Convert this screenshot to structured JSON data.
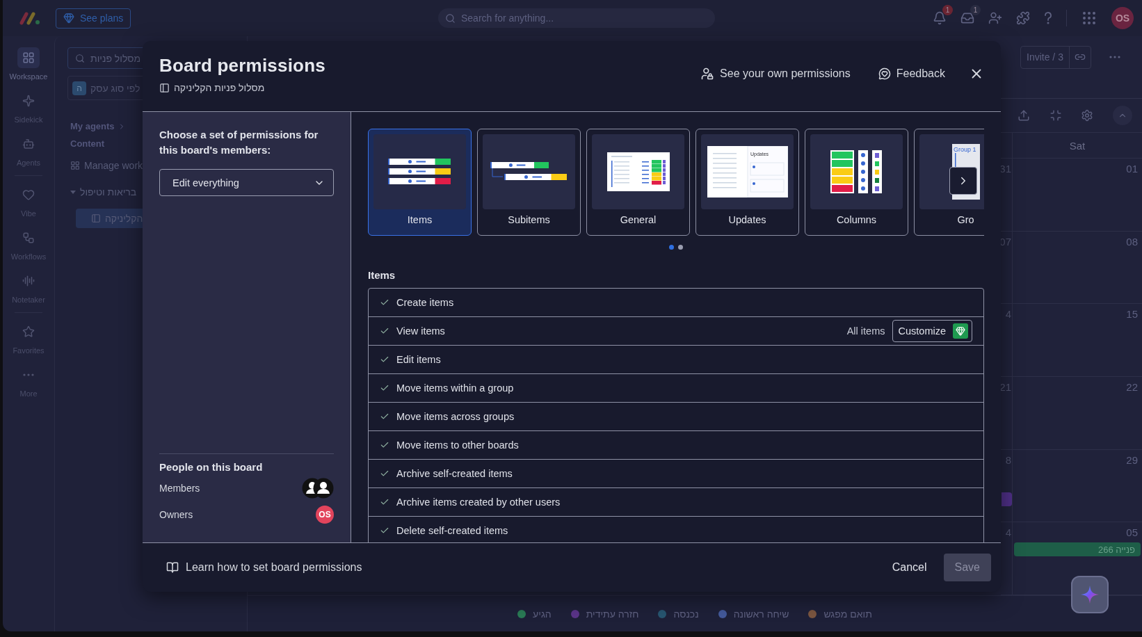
{
  "top_bar": {
    "see_plans": "See plans",
    "search": {
      "placeholder": "Search for anything..."
    },
    "notification_count": "1",
    "inbox_count": "1",
    "avatar": "OS"
  },
  "rail": [
    {
      "label": "Workspace",
      "selected": true
    },
    {
      "label": "Sidekick",
      "selected": false
    },
    {
      "label": "Agents",
      "selected": false
    },
    {
      "label": "Vibe",
      "selected": false
    },
    {
      "label": "Workflows",
      "selected": false
    },
    {
      "label": "Notetaker",
      "selected": false
    },
    {
      "label": "Favorites",
      "selected": false
    },
    {
      "label": "More",
      "selected": false
    }
  ],
  "sidebar": {
    "search": {
      "value": "מסלול פניות"
    },
    "workspace": {
      "initial": "ה",
      "name": "לפי סוג עסק"
    },
    "my_agents": "My agents",
    "section": "Content",
    "items": [
      {
        "label": "Manage work",
        "selected": false
      },
      {
        "label": "בריאות וטיפול",
        "selected": false,
        "expanded": true,
        "children": [
          {
            "label": "הקליניקה",
            "selected": true
          }
        ]
      }
    ]
  },
  "board": {
    "invite": "Invite / 3",
    "calendar": {
      "day": "Sat",
      "weeks": [
        {
          "previous": "31",
          "date": "01"
        },
        {
          "previous": "07",
          "date": "08"
        },
        {
          "previous": "4",
          "date": "15"
        },
        {
          "previous": "21",
          "date": "22"
        },
        {
          "previous": "8",
          "date": "29",
          "previous_event": {
            "color": "#4e2f86"
          }
        },
        {
          "previous": "4",
          "date": "05",
          "event": {
            "text": "פנייה 266",
            "color": "#1e5e48"
          }
        }
      ]
    },
    "legend": [
      {
        "label": "תואם מפגש",
        "color": "#7a5540"
      },
      {
        "label": "שיחה ראשונה",
        "color": "#43599a"
      },
      {
        "label": "נכנסה",
        "color": "#275570"
      },
      {
        "label": "חזרה עתידית",
        "color": "#5a3488"
      },
      {
        "label": "הגיע",
        "color": "#2a7a55"
      }
    ]
  },
  "modal": {
    "title": "Board permissions",
    "board_name": "מסלול פניות הקליניקה",
    "own_permissions": "See your own permissions",
    "feedback": "Feedback",
    "prompt": "Choose a set of permissions for this board's members:",
    "preset": {
      "value": "Edit everything"
    },
    "people": {
      "title": "People on this board",
      "members": "Members",
      "owners": "Owners",
      "owner_avatar": "OS"
    },
    "categories": [
      {
        "label": "Items",
        "kind": "items",
        "selected": true
      },
      {
        "label": "Subitems",
        "kind": "subitems",
        "selected": false
      },
      {
        "label": "General",
        "kind": "general",
        "selected": false
      },
      {
        "label": "Updates",
        "kind": "updates",
        "selected": false,
        "thumbnail_text": "Updates"
      },
      {
        "label": "Columns",
        "kind": "columns",
        "selected": false
      },
      {
        "label": "Gro",
        "kind": "groups",
        "selected": false,
        "thumbnail_text": "Group 1"
      }
    ],
    "pages": [
      {
        "selected": true
      },
      {
        "selected": false
      }
    ],
    "section_title": "Items",
    "permissions": [
      {
        "label": "Create items",
        "checked": true
      },
      {
        "label": "View items",
        "checked": true,
        "scope": "All items",
        "customize": "Customize"
      },
      {
        "label": "Edit items",
        "checked": true
      },
      {
        "label": "Move items within a group",
        "checked": true
      },
      {
        "label": "Move items across groups",
        "checked": true
      },
      {
        "label": "Move items to other boards",
        "checked": true
      },
      {
        "label": "Archive self-created items",
        "checked": true
      },
      {
        "label": "Archive items created by other users",
        "checked": true
      },
      {
        "label": "Delete self-created items",
        "checked": true
      }
    ],
    "learn_link": "Learn how to set board permissions",
    "cancel": "Cancel",
    "save": {
      "label": "Save",
      "disabled": true
    }
  }
}
